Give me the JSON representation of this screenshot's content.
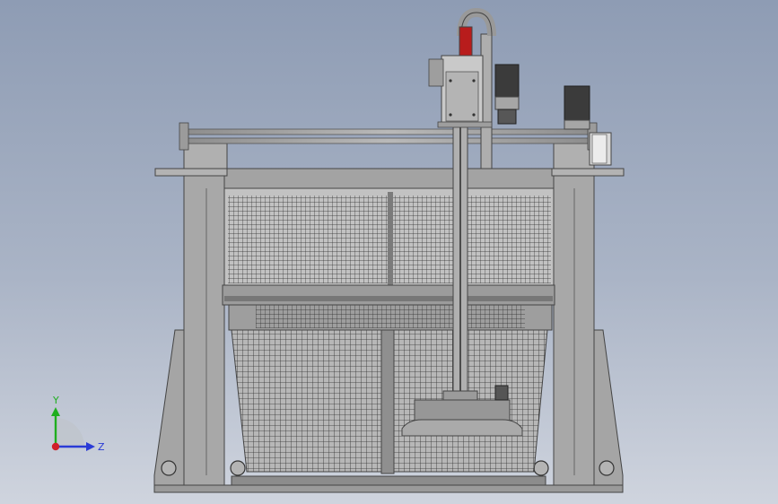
{
  "viewport": {
    "background_top": "#8e9cb4",
    "background_bottom": "#cfd4de"
  },
  "model": {
    "frame_color": "#a9a9a9",
    "frame_dark": "#5e5e5e",
    "mesh_color": "#3a3a3a",
    "accent_red": "#b81c1c"
  },
  "triad": {
    "y_label": "Y",
    "z_label": "Z",
    "y_color": "#1fae1f",
    "z_color": "#2a3bd6",
    "x_color": "#d0202a"
  }
}
